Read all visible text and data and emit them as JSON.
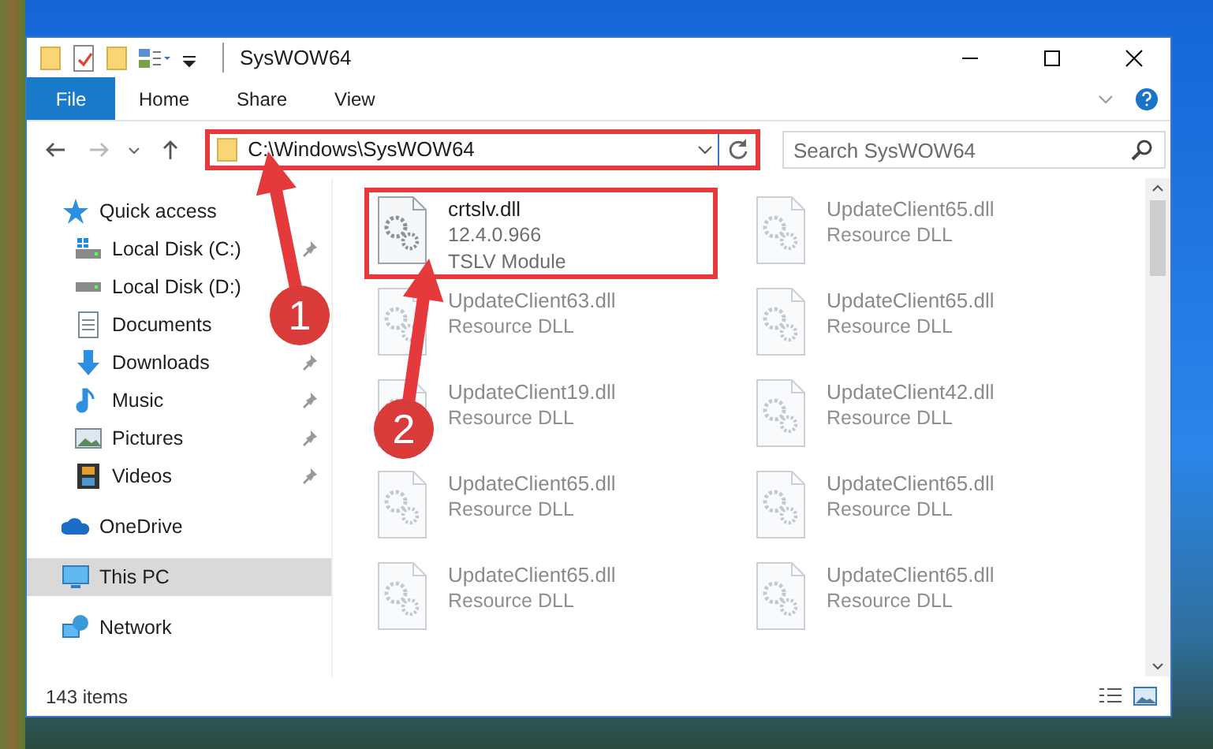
{
  "window": {
    "title": "SysWOW64"
  },
  "ribbon_tabs": [
    {
      "label": "File",
      "kind": "file"
    },
    {
      "label": "Home",
      "kind": "tab"
    },
    {
      "label": "Share",
      "kind": "tab"
    },
    {
      "label": "View",
      "kind": "tab"
    }
  ],
  "address_bar": {
    "path": "C:\\Windows\\SysWOW64",
    "highlighted": true
  },
  "search": {
    "placeholder": "Search SysWOW64"
  },
  "sidebar": {
    "items": [
      {
        "label": "Quick access",
        "selected": false,
        "children": [
          {
            "label": "Local Disk (C:)",
            "selected": false,
            "pinned": true
          },
          {
            "label": "Local Disk (D:)",
            "selected": false,
            "pinned": false
          },
          {
            "label": "Documents",
            "selected": false,
            "pinned": false
          },
          {
            "label": "Downloads",
            "selected": false,
            "pinned": true
          },
          {
            "label": "Music",
            "selected": false,
            "pinned": true
          },
          {
            "label": "Pictures",
            "selected": false,
            "pinned": true
          },
          {
            "label": "Videos",
            "selected": false,
            "pinned": true
          }
        ]
      },
      {
        "label": "OneDrive",
        "selected": false
      },
      {
        "label": "This PC",
        "selected": true
      },
      {
        "label": "Network",
        "selected": false
      }
    ]
  },
  "files": [
    {
      "name": "crtslv.dll",
      "details": [
        "12.4.0.966",
        "TSLV Module"
      ],
      "highlighted": true,
      "blurred": false
    },
    {
      "name": "UpdateClient65.dll",
      "details": [
        "Resource DLL"
      ],
      "blurred": true
    },
    {
      "name": "UpdateClient63.dll",
      "details": [
        "Resource DLL"
      ],
      "blurred": true
    },
    {
      "name": "UpdateClient65.dll",
      "details": [
        "Resource DLL"
      ],
      "blurred": true
    },
    {
      "name": "UpdateClient19.dll",
      "details": [
        "Resource DLL"
      ],
      "blurred": true
    },
    {
      "name": "UpdateClient42.dll",
      "details": [
        "Resource DLL"
      ],
      "blurred": true
    },
    {
      "name": "UpdateClient65.dll",
      "details": [
        "Resource DLL"
      ],
      "blurred": true
    },
    {
      "name": "UpdateClient65.dll",
      "details": [
        "Resource DLL"
      ],
      "blurred": true
    },
    {
      "name": "UpdateClient65.dll",
      "details": [
        "Resource DLL"
      ],
      "blurred": true
    },
    {
      "name": "UpdateClient65.dll",
      "details": [
        "Resource DLL"
      ],
      "blurred": true
    }
  ],
  "status_bar": {
    "item_count": "143 items"
  },
  "annotations": [
    {
      "label": "1"
    },
    {
      "label": "2"
    }
  ]
}
